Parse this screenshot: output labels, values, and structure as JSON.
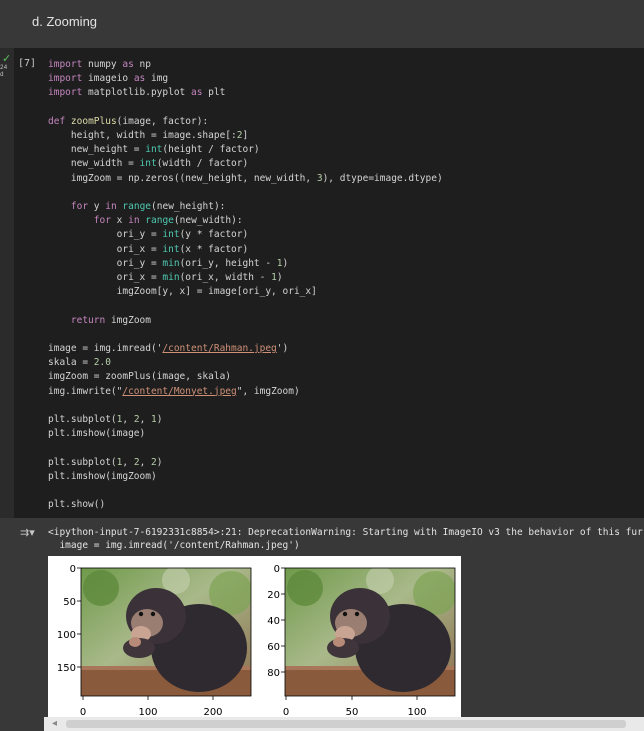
{
  "section": {
    "title": "d. Zooming"
  },
  "cell": {
    "execution_count": "[7]",
    "runtime_badge": "24 d",
    "code": [
      "import numpy as np",
      "import imageio as img",
      "import matplotlib.pyplot as plt",
      "",
      "def zoomPlus(image, factor):",
      "    height, width = image.shape[:2]",
      "    new_height = int(height / factor)",
      "    new_width = int(width / factor)",
      "    imgZoom = np.zeros((new_height, new_width, 3), dtype=image.dtype)",
      "",
      "    for y in range(new_height):",
      "        for x in range(new_width):",
      "            ori_y = int(y * factor)",
      "            ori_x = int(x * factor)",
      "            ori_y = min(ori_y, height - 1)",
      "            ori_x = min(ori_x, width - 1)",
      "            imgZoom[y, x] = image[ori_y, ori_x]",
      "",
      "    return imgZoom",
      "",
      "image = img.imread('/content/Rahman.jpeg')",
      "skala = 2.0",
      "imgZoom = zoomPlus(image, skala)",
      "img.imwrite(\"/content/Monyet.jpeg\", imgZoom)",
      "",
      "plt.subplot(1, 2, 1)",
      "plt.imshow(image)",
      "",
      "plt.subplot(1, 2, 2)",
      "plt.imshow(imgZoom)",
      "",
      "plt.show()"
    ]
  },
  "output": {
    "warning_lines": [
      "<ipython-input-7-6192331c8854>:21: DeprecationWarning: Starting with ImageIO v3 the behavior of this fur",
      "  image = img.imread('/content/Rahman.jpeg')"
    ]
  },
  "figure": {
    "left": {
      "xticks": [
        "0",
        "100",
        "200"
      ],
      "yticks": [
        "0",
        "50",
        "100",
        "150"
      ]
    },
    "right": {
      "xticks": [
        "0",
        "50",
        "100"
      ],
      "yticks": [
        "0",
        "20",
        "40",
        "60",
        "80"
      ]
    }
  },
  "colors": {
    "keyword": "#c586c0",
    "function": "#dcdcaa",
    "builtin": "#4ec9b0",
    "number": "#b5cea8",
    "string": "#ce9178",
    "success": "#59c25a"
  }
}
